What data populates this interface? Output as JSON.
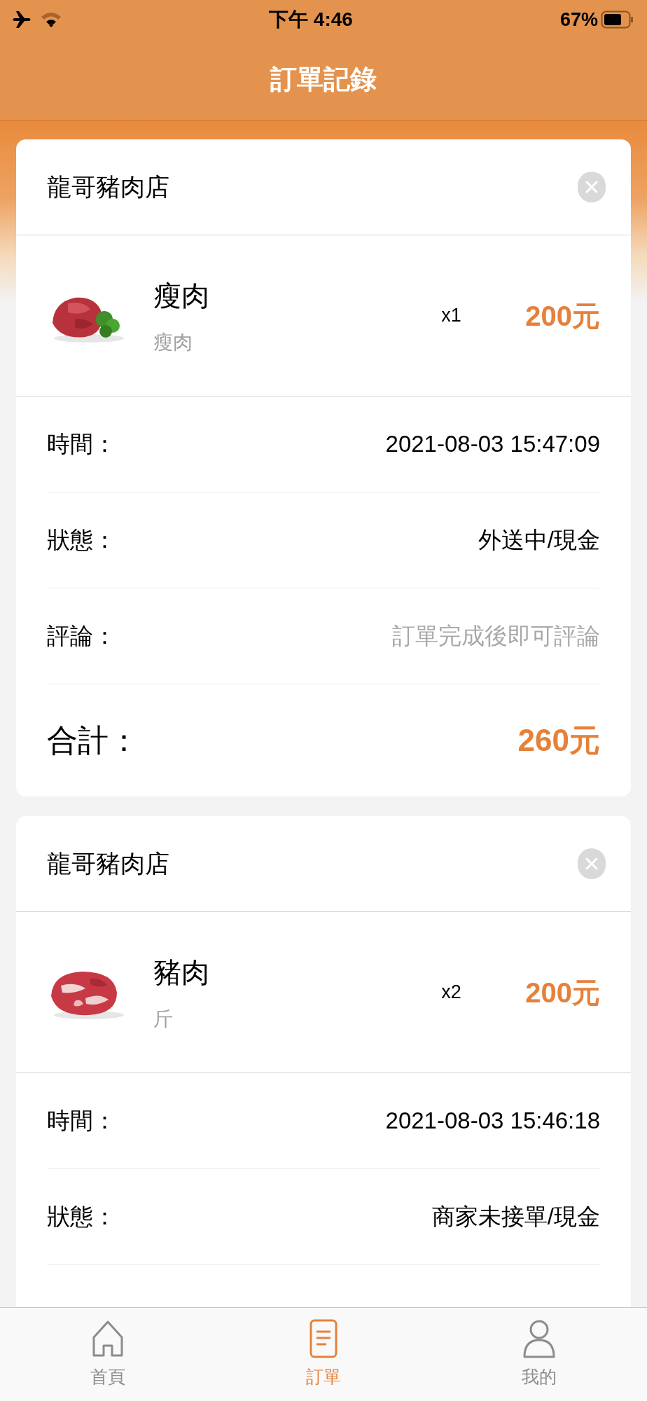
{
  "status_bar": {
    "time": "下午 4:46",
    "battery": "67%"
  },
  "header": {
    "title": "訂單記錄"
  },
  "orders": [
    {
      "store": "龍哥豬肉店",
      "item": {
        "name": "瘦肉",
        "unit": "瘦肉",
        "quantity": "x1",
        "price": "200元"
      },
      "details": [
        {
          "label": "時間：",
          "value": "2021-08-03 15:47:09",
          "kind": "plain"
        },
        {
          "label": "狀態：",
          "value": "外送中/現金",
          "kind": "plain"
        },
        {
          "label": "評論：",
          "value": "訂單完成後即可評論",
          "kind": "hint"
        }
      ],
      "total": {
        "label": "合計：",
        "value": "260元"
      }
    },
    {
      "store": "龍哥豬肉店",
      "item": {
        "name": "豬肉",
        "unit": "斤",
        "quantity": "x2",
        "price": "200元"
      },
      "details": [
        {
          "label": "時間：",
          "value": "2021-08-03 15:46:18",
          "kind": "plain"
        },
        {
          "label": "狀態：",
          "value": "商家未接單/現金",
          "kind": "plain"
        }
      ]
    }
  ],
  "tabs": [
    {
      "label": "首頁",
      "kind": "home",
      "selected": false
    },
    {
      "label": "訂單",
      "kind": "orders",
      "selected": true
    },
    {
      "label": "我的",
      "kind": "profile",
      "selected": false
    }
  ]
}
